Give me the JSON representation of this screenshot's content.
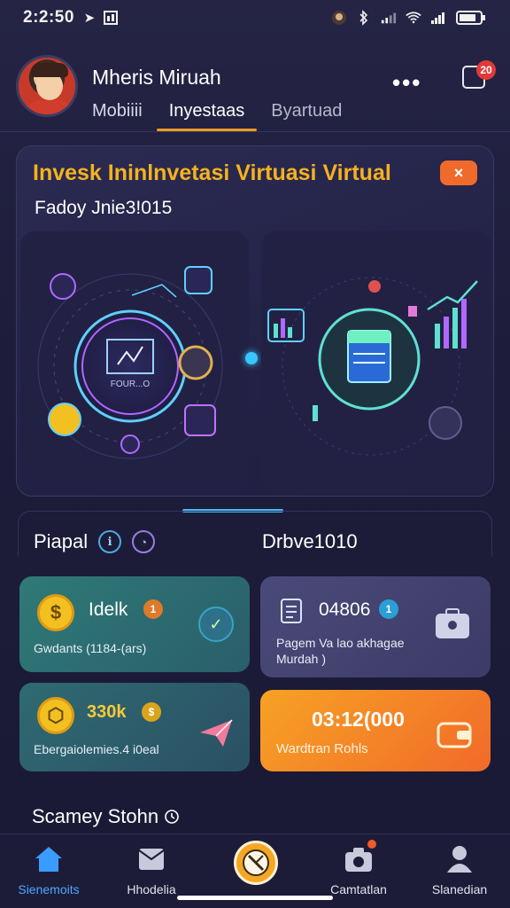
{
  "status_bar": {
    "time": "2:2:50"
  },
  "header": {
    "user_name": "Mheris Miruah",
    "menu_icon": "more-dots-icon",
    "notification_count": "20",
    "tabs": [
      {
        "label": "Mobiiii",
        "active": false
      },
      {
        "label": "Inyestaas",
        "active": true
      },
      {
        "label": "Byartuad",
        "active": false
      }
    ]
  },
  "hero": {
    "title": "Invesk Ininlnvetasi Virtuasi Virtual",
    "close_label": "×",
    "subtitle": "Fadoy Jnie3!015",
    "left_panel_text": "FOUR...O"
  },
  "section": {
    "left_label": "Piapal",
    "right_label": "Drbve1010"
  },
  "cards": [
    {
      "title": "Idelk",
      "badge": "1",
      "subtitle": "Gwdants (1184-(ars)",
      "coin": "$"
    },
    {
      "title": "04806",
      "badge": "1",
      "subtitle": "Pagem Va lao akhagae Murdah )"
    },
    {
      "title": "330k",
      "badge": "$",
      "subtitle": "Ebergaiolemies.4 i0eal"
    },
    {
      "title": "03:12(000",
      "subtitle": "Wardtran Rohls"
    }
  ],
  "bottom_section": {
    "label": "Scamey Stohn"
  },
  "nav": [
    {
      "label": "Sienemoits",
      "active": true
    },
    {
      "label": "Hhodelia",
      "active": false
    },
    {
      "label": "Camtatlan",
      "active": false
    },
    {
      "label": "Slanedian",
      "active": false
    }
  ],
  "colors": {
    "accent_orange": "#f59a23",
    "accent_blue": "#4aa9ff",
    "gold": "#f5b21f"
  }
}
